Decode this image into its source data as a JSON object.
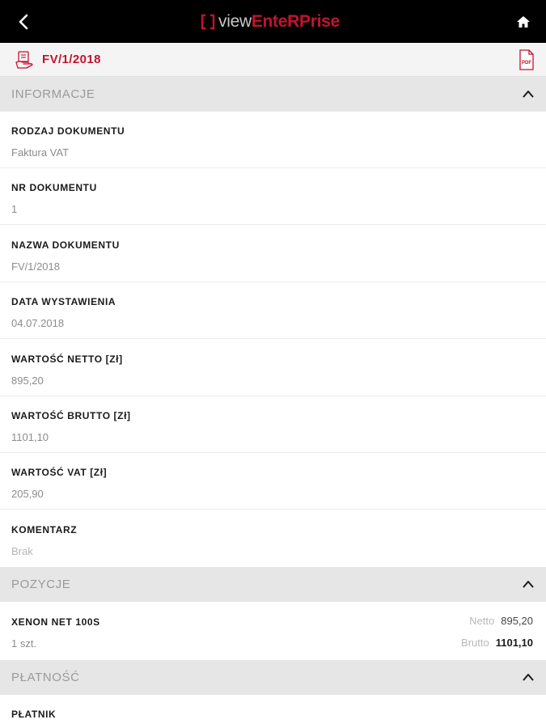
{
  "app": {
    "logo_prefix": "view",
    "logo_brand": "EnteRPrise",
    "colors": {
      "accent": "#c4122f",
      "topbar": "#000000",
      "section_bg": "#e6e6e6"
    },
    "icons": {
      "back": "chevron-left-icon",
      "home": "home-icon",
      "doc": "document-hand-icon",
      "pdf": "pdf-file-icon",
      "collapse": "chevron-up-icon"
    }
  },
  "document": {
    "title": "FV/1/2018"
  },
  "sections": {
    "informacje": "INFORMACJE",
    "pozycje": "POZYCJE",
    "platnosc": "PŁATNOŚĆ"
  },
  "fields": [
    {
      "label": "RODZAJ DOKUMENTU",
      "value": "Faktura VAT"
    },
    {
      "label": "NR DOKUMENTU",
      "value": "1"
    },
    {
      "label": "NAZWA DOKUMENTU",
      "value": "FV/1/2018"
    },
    {
      "label": "DATA WYSTAWIENIA",
      "value": "04.07.2018"
    },
    {
      "label": "WARTOŚĆ NETTO [Zł]",
      "value": "895,20"
    },
    {
      "label": "WARTOŚĆ BRUTTO [Zł]",
      "value": "1101,10"
    },
    {
      "label": "WARTOŚĆ VAT [Zł]",
      "value": "205,90"
    },
    {
      "label": "KOMENTARZ",
      "value": "Brak"
    }
  ],
  "positions": [
    {
      "name": "XENON NET 100S",
      "qty": "1 szt.",
      "netto_label": "Netto",
      "netto": "895,20",
      "brutto_label": "Brutto",
      "brutto": "1101,10"
    }
  ],
  "payment": {
    "label": "PŁATNIK"
  }
}
